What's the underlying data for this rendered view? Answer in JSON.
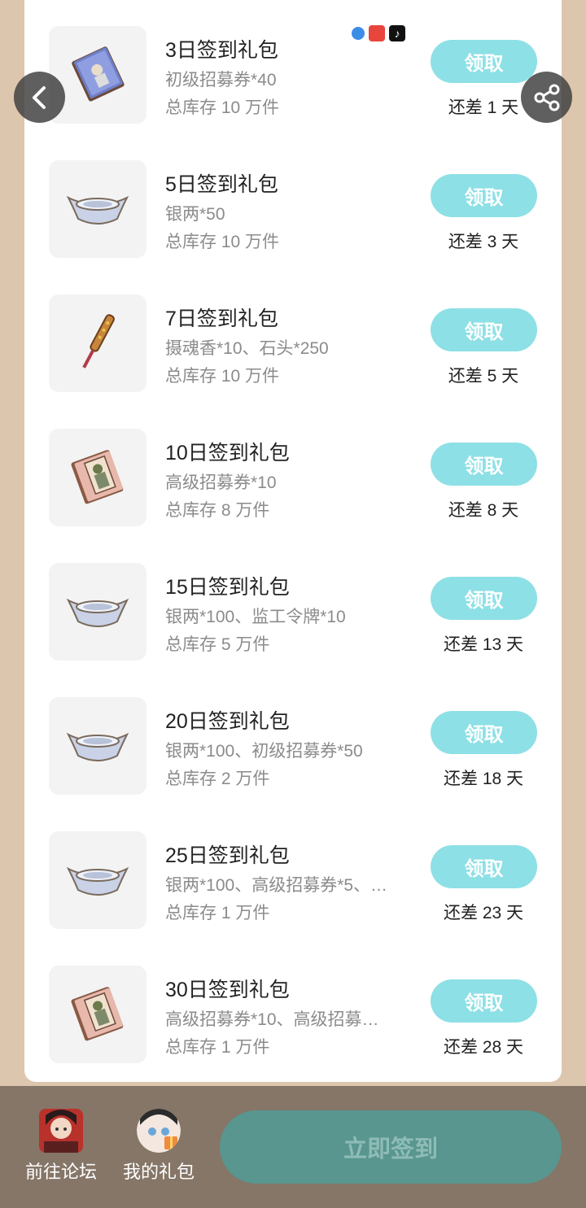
{
  "gift_list": [
    {
      "title": "3日签到礼包",
      "desc": "初级招募券*40",
      "stock": "总库存 10 万件",
      "button": "领取",
      "remain": "还差 1 天",
      "icon": "book-icon"
    },
    {
      "title": "5日签到礼包",
      "desc": "银两*50",
      "stock": "总库存 10 万件",
      "button": "领取",
      "remain": "还差 3 天",
      "icon": "silver-ingot-icon"
    },
    {
      "title": "7日签到礼包",
      "desc": "摄魂香*10、石头*250",
      "stock": "总库存 10 万件",
      "button": "领取",
      "remain": "还差 5 天",
      "icon": "incense-icon"
    },
    {
      "title": "10日签到礼包",
      "desc": "高级招募券*10",
      "stock": "总库存 8 万件",
      "button": "领取",
      "remain": "还差 8 天",
      "icon": "portrait-book-icon"
    },
    {
      "title": "15日签到礼包",
      "desc": "银两*100、监工令牌*10",
      "stock": "总库存 5 万件",
      "button": "领取",
      "remain": "还差 13 天",
      "icon": "silver-ingot-icon"
    },
    {
      "title": "20日签到礼包",
      "desc": "银两*100、初级招募券*50",
      "stock": "总库存 2 万件",
      "button": "领取",
      "remain": "还差 18 天",
      "icon": "silver-ingot-icon"
    },
    {
      "title": "25日签到礼包",
      "desc": "银两*100、高级招募券*5、…",
      "stock": "总库存 1 万件",
      "button": "领取",
      "remain": "还差 23 天",
      "icon": "silver-ingot-icon"
    },
    {
      "title": "30日签到礼包",
      "desc": "高级招募券*10、高级招募…",
      "stock": "总库存 1 万件",
      "button": "领取",
      "remain": "还差 28 天",
      "icon": "portrait-book-icon"
    }
  ],
  "bottom_bar": {
    "forum_label": "前往论坛",
    "my_gifts_label": "我的礼包",
    "signin_label": "立即签到"
  },
  "colors": {
    "background": "#dcc6ad",
    "claim_button": "#8de0e5",
    "signin_button": "#58968f",
    "bottom_bar": "#857668"
  }
}
